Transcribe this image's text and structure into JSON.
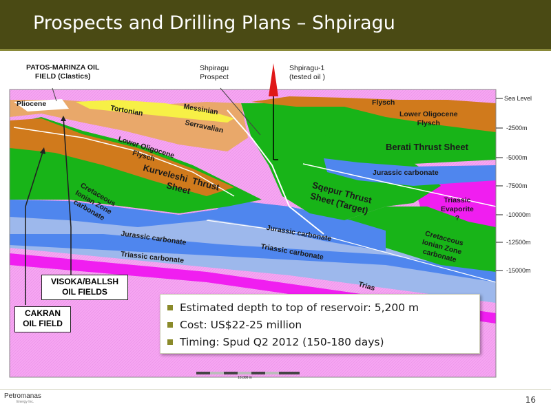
{
  "slide": {
    "title": "Prospects and Drilling Plans – Shpiragu",
    "page_number": "16",
    "logo_text": "Petromanas",
    "logo_subtext": "Energy Inc."
  },
  "diagram": {
    "top_labels": {
      "patos": "PATOS-MARINZA OIL\nFIELD (Clastics)",
      "prospect": "Shpiragu\nProspect",
      "well": "Shpiragu-1\n(tested oil )"
    },
    "depth_ticks": [
      "Sea Level",
      "-2500m",
      "-5000m",
      "-7500m",
      "-10000m",
      "-12500m",
      "-15000m"
    ],
    "layer_labels": {
      "pliocene": "Pliocene",
      "tortonian": "Tortonian",
      "messinian": "Messinian",
      "serravalian": "Serravalian",
      "flysch_right": "Flysch",
      "lower_oligocene_right": "Lower Oligocene\nFlysch",
      "berati": "Berati Thrust Sheet",
      "jurassic_right": "Jurassic carbonate",
      "lower_oligocene_left": "Lower Oligocene\nFlysch",
      "kurveleshi": "Kurveleshi  Thrust\nSheet",
      "sqepur": "Sqepur Thrust\nSheet (Target)",
      "triassic_evaporite": "Triassic\nEvaporite\n?",
      "cretaceous_left": "Cretaceous\nIonian Zone\ncarbonate",
      "jurassic_mid": "Jurassic carbonate",
      "jurassic_left": "Jurassic carbonate",
      "cretaceous_right": "Cretaceous\nIonian Zone\ncarbonate",
      "triassic_mid": "Triassic carbonate",
      "triassic_left": "Triassic carbonate",
      "trias_cut": "Trias"
    },
    "scale_label": "10,000 m",
    "callouts": {
      "visoka": "VISOKA/BALLSH\nOIL FIELDS",
      "cakran": "CAKRAN\nOIL FIELD"
    },
    "colors": {
      "flysch_orange": "#d07a1c",
      "neogene_tan": "#e9a86a",
      "tortonian_yellow": "#f7f046",
      "carbonate_green": "#18b418",
      "jurassic_blue": "#4f86ee",
      "triassic_lightblue": "#9db8ec",
      "evaporite_magenta": "#f01ef0",
      "basement_pink": "#f6a6f2",
      "well_red": "#e01818"
    }
  },
  "bullets": [
    "Estimated depth to top of reservoir: 5,200 m",
    "Cost: US$22-25 million",
    "Timing: Spud Q2 2012 (150-180 days)"
  ]
}
